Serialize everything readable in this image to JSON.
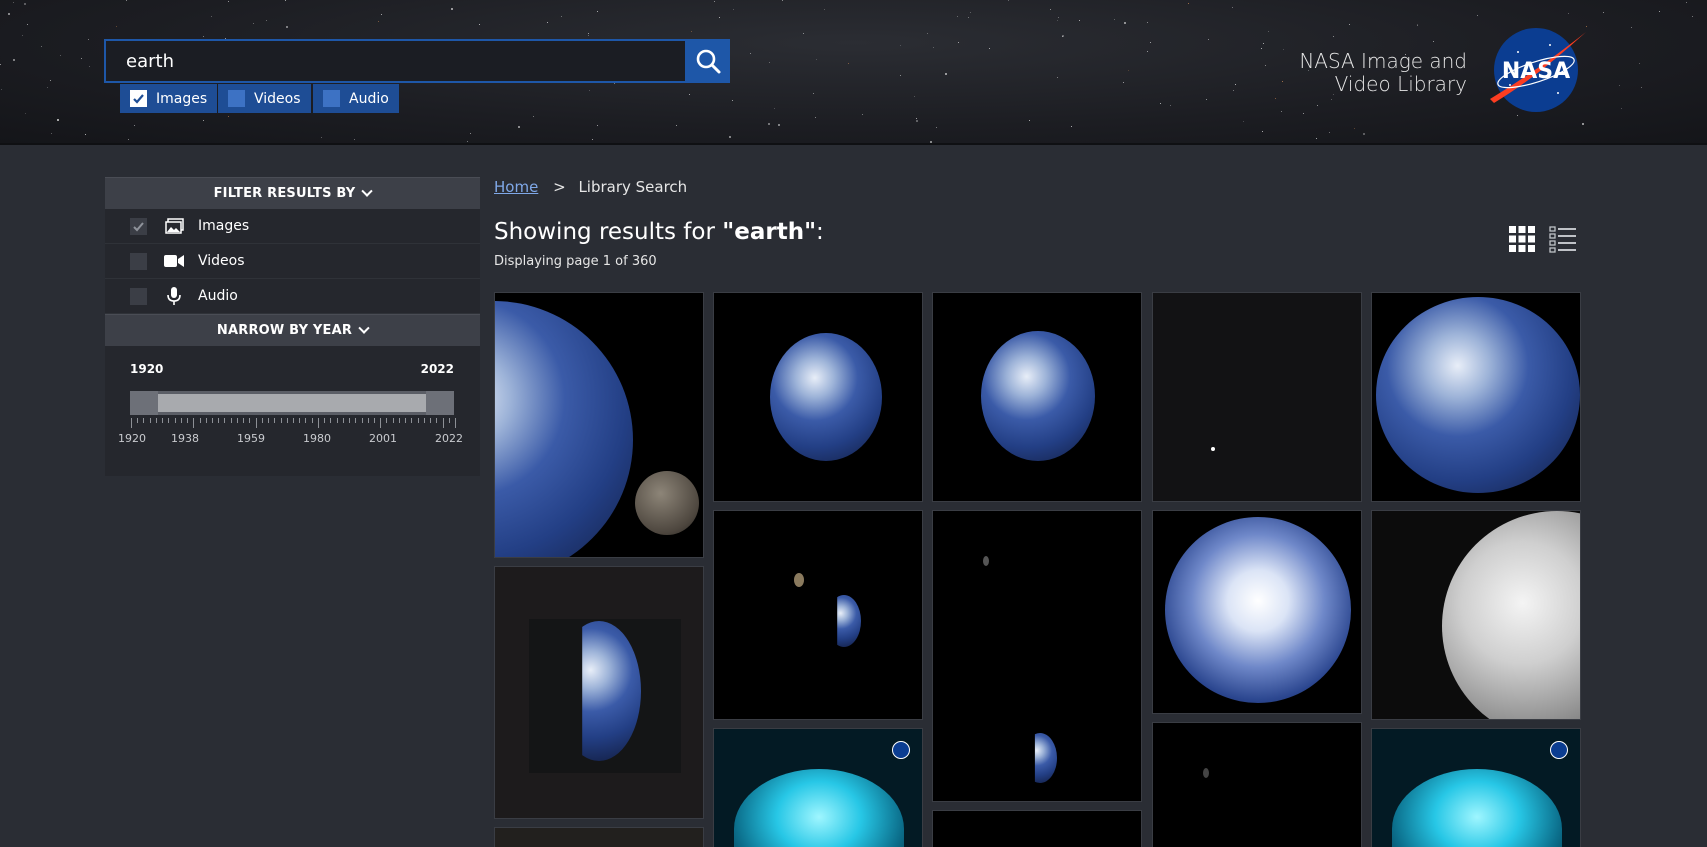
{
  "search": {
    "query": "earth",
    "button_label": "Search"
  },
  "media_types": [
    {
      "label": "Images",
      "checked": true
    },
    {
      "label": "Videos",
      "checked": false
    },
    {
      "label": "Audio",
      "checked": false
    }
  ],
  "site": {
    "title_line1": "NASA Image and",
    "title_line2": "Video Library",
    "logo_text": "NASA"
  },
  "filter_panel": {
    "filter_heading": "FILTER RESULTS BY",
    "filters": [
      {
        "label": "Images",
        "icon": "image-icon",
        "checked": true
      },
      {
        "label": "Videos",
        "icon": "video-camera-icon",
        "checked": false
      },
      {
        "label": "Audio",
        "icon": "microphone-icon",
        "checked": false
      }
    ],
    "year_heading": "NARROW BY YEAR",
    "year_start": "1920",
    "year_end": "2022",
    "tick_labels": [
      "1920",
      "1938",
      "1959",
      "1980",
      "2001",
      "2022"
    ]
  },
  "breadcrumb": {
    "home": "Home",
    "separator": ">",
    "current": "Library Search"
  },
  "results": {
    "prefix": "Showing results for ",
    "query_display": "\"earth\"",
    "suffix": ":",
    "page_info": "Displaying page 1 of 360"
  },
  "colors": {
    "accent_blue": "#1e57a8",
    "page_bg": "#2a2d34",
    "panel_header_bg": "#3d4048"
  }
}
